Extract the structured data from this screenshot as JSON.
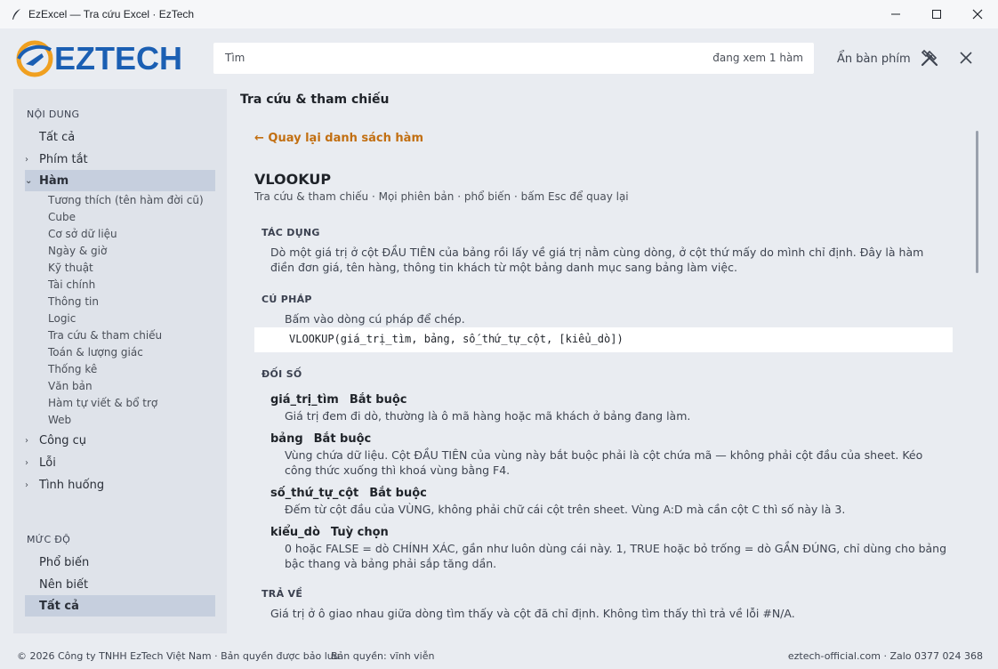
{
  "window": {
    "title": "EzExcel — Tra cứu Excel · EzTech"
  },
  "header": {
    "logo_text": "EZTECH",
    "search_placeholder": "Tìm",
    "search_status": "đang xem 1 hàm",
    "hide_keyboard": "Ẩn bàn phím"
  },
  "sidebar": {
    "content_heading": "NỘI DUNG",
    "items": [
      {
        "label": "Tất cả"
      },
      {
        "label": "Phím tắt",
        "chevron": "›"
      },
      {
        "label": "Hàm",
        "chevron": "⌄"
      },
      {
        "label": "Công cụ",
        "chevron": "›"
      },
      {
        "label": "Lỗi",
        "chevron": "›"
      },
      {
        "label": "Tình huống",
        "chevron": "›"
      }
    ],
    "sub_items": [
      "Tương thích (tên hàm đời cũ)",
      "Cube",
      "Cơ sở dữ liệu",
      "Ngày & giờ",
      "Kỹ thuật",
      "Tài chính",
      "Thông tin",
      "Logic",
      "Tra cứu & tham chiếu",
      "Toán & lượng giác",
      "Thống kê",
      "Văn bản",
      "Hàm tự viết & bổ trợ",
      "Web"
    ],
    "level_heading": "MỨC ĐỘ",
    "levels": [
      {
        "label": "Phổ biến"
      },
      {
        "label": "Nên biết"
      },
      {
        "label": "Tất cả"
      }
    ]
  },
  "main": {
    "category_title": "Tra cứu & tham chiếu",
    "back_link": "← Quay lại danh sách hàm",
    "function_name": "VLOOKUP",
    "meta": "Tra cứu & tham chiếu · Mọi phiên bản · phổ biến · bấm Esc để quay lại",
    "purpose_label": "TÁC DỤNG",
    "purpose_text": "Dò một giá trị ở cột ĐẦU TIÊN của bảng rồi lấy về giá trị nằm cùng dòng, ở cột thứ mấy do mình chỉ định. Đây là hàm điền đơn giá, tên hàng, thông tin khách từ một bảng danh mục sang bảng làm việc.",
    "syntax_label": "CÚ PHÁP",
    "syntax_hint": "Bấm vào dòng cú pháp để chép.",
    "syntax": "VLOOKUP(giá_trị_tìm, bảng, số_thứ_tự_cột, [kiểu_dò])",
    "args_label": "ĐỐI SỐ",
    "args": [
      {
        "name": "giá_trị_tìm",
        "req": "Bắt buộc",
        "desc": "Giá trị đem đi dò, thường là ô mã hàng hoặc mã khách ở bảng đang làm."
      },
      {
        "name": "bảng",
        "req": "Bắt buộc",
        "desc": "Vùng chứa dữ liệu. Cột ĐẦU TIÊN của vùng này bắt buộc phải là cột chứa mã — không phải cột đầu của sheet. Kéo công thức xuống thì khoá vùng bằng F4."
      },
      {
        "name": "số_thứ_tự_cột",
        "req": "Bắt buộc",
        "desc": "Đếm từ cột đầu của VÙNG, không phải chữ cái cột trên sheet. Vùng A:D mà cần cột C thì số này là 3."
      },
      {
        "name": "kiểu_dò",
        "req": "Tuỳ chọn",
        "desc": "0 hoặc FALSE = dò CHÍNH XÁC, gần như luôn dùng cái này. 1, TRUE hoặc bỏ trống = dò GẦN ĐÚNG, chỉ dùng cho bảng bậc thang và bảng phải sắp tăng dần."
      }
    ],
    "returns_label": "TRẢ VỀ",
    "returns_text": "Giá trị ở ô giao nhau giữa dòng tìm thấy và cột đã chỉ định. Không tìm thấy thì trả về lỗi #N/A."
  },
  "footer": {
    "copyright": "© 2026 Công ty TNHH EzTech Việt Nam · Bản quyền được bảo lưu",
    "license": "Bản quyền: vĩnh viễn",
    "contact": "eztech-official.com · Zalo 0377 024 368"
  },
  "colors": {
    "accent": "#c26f12",
    "brand": "#1b5fb3",
    "sidebar_bg": "#dfe3ea",
    "active_bg": "#c6cfde"
  }
}
